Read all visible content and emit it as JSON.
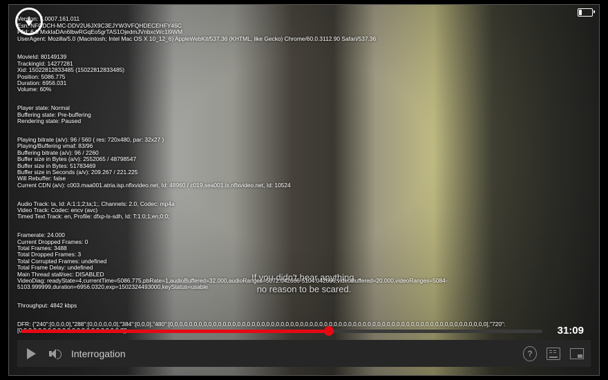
{
  "debug": {
    "b1": "Version: 5.0007.161.011\nEsn: NFCDCH-MC-DDV2U6JX9C3EJYW3VFQHDECEHFY46C\nPfid: 6.8 MxkIaDAn6lbwRGqEo5grTAS1OjedmJVnbxcWc1l9WM\nUserAgent: Mozilla/5.0 (Macintosh; Intel Mac OS X 10_12_6) AppleWebKit/537.36 (KHTML, like Gecko) Chrome/60.0.3112.90 Safari/537.36",
    "b2": "MovieId: 80149139\nTrackingId: 14277281\nXid: 15022812833485 (15022812833485)\nPosition: 5086.775\nDuration: 6956.031\nVolume: 60%",
    "b3": "Player state: Normal\nBuffering state: Pre-buffering\nRendering state: Paused",
    "b4": "Playing bitrate (a/v): 96 / 560 ( res: 720x480, par: 32x27 )\nPlaying/Buffering vmaf: 83/96\nBuffering bitrate (a/v): 96 / 2260\nBuffer size in Bytes (a/v): 2552065 / 48798547\nBuffer size in Bytes: 51783469\nBuffer size in Seconds (a/v): 209.267 / 221.225\nWill Rebuffer: false\nCurrent CDN (a/v): c003.maa001.atria.isp.nflxvideo.net, Id: 48960 / c019.sea001.ix.nflxvideo.net, Id: 10524",
    "b5": "Audio Track: ta, Id: A:1:1;2;ta;1;, Channels: 2.0, Codec: mp4a\nVideo Track: Codec: encv (avc)\nTimed Text Track: en, Profile: dfxp-ls-sdh, Id: T:1:0;1;en;0;0;",
    "b6": "Framerate: 24.000\nCurrent Dropped Frames: 0\nTotal Frames: 3488\nTotal Dropped Frames: 3\nTotal Corrupted Frames: undefined\nTotal Frame Delay: undefined\nMain Thread stall/sec: DISABLED\nVideoDiag: readyState=4,currentTime=5086.775,pbRate=1,audioBuffered=32.000,audioRanges=5072.042666-5104.042666,videoBuffered=20.000,videoRanges=5084-5103.999999,duration=6956.0320,exp=1502324493000,keyStatus=usable",
    "b7": "Throughput: 4842 kbps",
    "b8": "DFR: {\"240\":[0,0,0,0],\"288\":[0,0,0,0,0,0],\"384\":[0,0,0],\"480\":[0,0,0,0,0,0,0,0,0,0,0,0,0,0,0,0,0,0,0,0,0,0,0,0,0,0,0,0,0,0,0,0,0,0,0,0,0,0,0,0,0,0,0,0,0,0,0,0,0,0,0,0,0,0,0,0,0,0,0,0,0,0,0,0,0,0],\"720\":[0,0,0,0,0,0,0,0,0,0,0,0,0,0,0,0,0,0,0,0,0,0]}"
  },
  "subtitle": {
    "l1": "If you didn't hear anything,",
    "l2": "no reason to be scared."
  },
  "time_remaining": "31:09",
  "title": "Interrogation"
}
